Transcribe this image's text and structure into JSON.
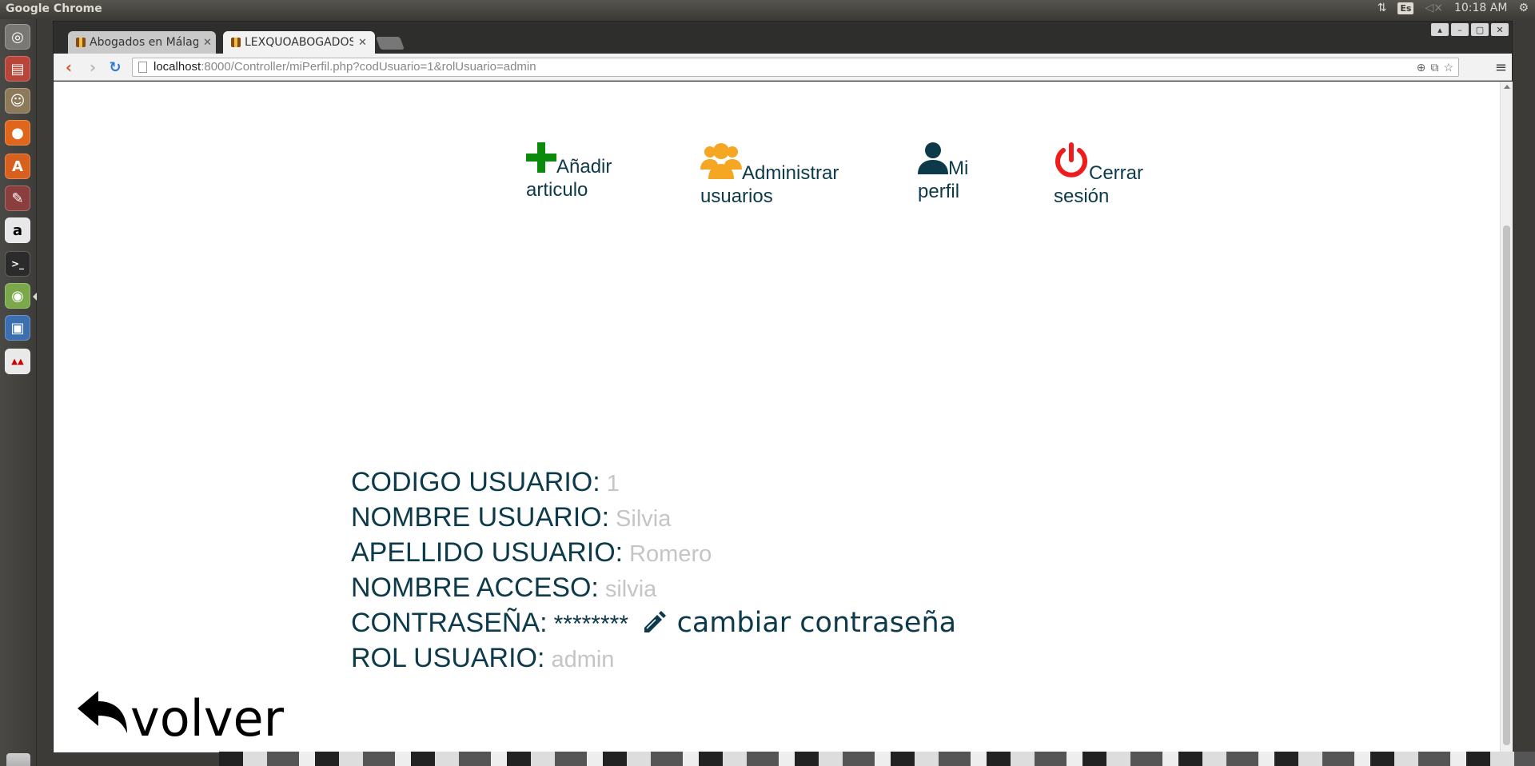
{
  "system": {
    "app_title": "Google Chrome",
    "keyboard_layout": "Es",
    "clock": "10:18 AM"
  },
  "launcher": {
    "items": [
      "ubuntu-logo",
      "files",
      "gimp",
      "firefox",
      "software-center",
      "system-settings",
      "amazon",
      "terminal",
      "chrome",
      "virtualbox",
      "other-app"
    ]
  },
  "browser": {
    "tabs": [
      {
        "title": "Abogados en Málaga",
        "active": false
      },
      {
        "title": "LEXQUOABOGADOS",
        "active": true
      }
    ],
    "url_host": "localhost",
    "url_rest": ":8000/Controller/miPerfil.php?codUsuario=1&rolUsuario=admin"
  },
  "page": {
    "nav": {
      "add_article": {
        "line1": "Añadir",
        "line2": "articulo",
        "icon": "plus-icon",
        "color": "#0b8a0b"
      },
      "manage_users": {
        "line1": "Administrar",
        "line2": "usuarios",
        "icon": "users-icon",
        "color": "#f5a623"
      },
      "my_profile": {
        "line1": "Mi",
        "line2": "perfil",
        "icon": "user-icon",
        "color": "#0c3a4a"
      },
      "logout": {
        "line1": "Cerrar",
        "line2": "sesión",
        "icon": "power-icon",
        "color": "#ee1c1c"
      }
    },
    "profile": {
      "code_label": "CODIGO USUARIO:",
      "code_value": "1",
      "name_label": "NOMBRE USUARIO:",
      "name_value": "Silvia",
      "surname_label": "APELLIDO USUARIO:",
      "surname_value": "Romero",
      "login_label": "NOMBRE ACCESO:",
      "login_value": "silvia",
      "password_label": "CONTRASEÑA:",
      "password_value": "********",
      "change_password": "cambiar contraseña",
      "role_label": "ROL USUARIO:",
      "role_value": "admin"
    },
    "back_label": "volver"
  }
}
